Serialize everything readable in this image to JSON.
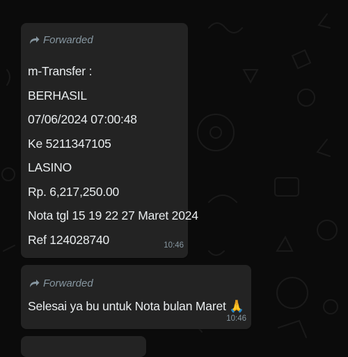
{
  "forwarded_label": "Forwarded",
  "messages": [
    {
      "lines": [
        "m-Transfer :",
        "BERHASIL",
        "07/06/2024 07:00:48",
        "Ke 5211347105",
        "LASINO",
        "Rp. 6,217,250.00",
        "Nota tgl 15 19 22 27 Maret 2024",
        "Ref 124028740"
      ],
      "time": "10:46"
    },
    {
      "text": "Selesai ya bu untuk Nota bulan Maret 🙏",
      "time": "10:46"
    }
  ],
  "colors": {
    "background": "#0b0b0b",
    "bubble": "#232323",
    "text": "#e9edef",
    "meta": "#8696a0"
  },
  "icons": [
    "forward-arrow-icon",
    "folded-hands-emoji"
  ]
}
